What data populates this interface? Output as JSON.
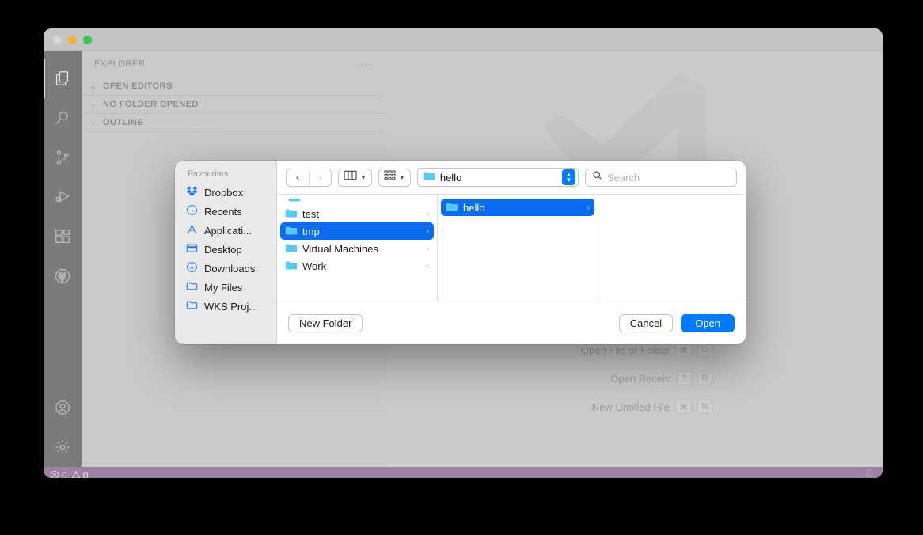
{
  "window": {
    "traffic_lights": [
      "close",
      "minimize",
      "maximize"
    ]
  },
  "activity_bar": {
    "items": [
      {
        "name": "explorer",
        "icon": "files-icon",
        "active": true
      },
      {
        "name": "search",
        "icon": "search-icon",
        "active": false
      },
      {
        "name": "source-control",
        "icon": "source-control-icon",
        "active": false
      },
      {
        "name": "run-and-debug",
        "icon": "run-debug-icon",
        "active": false
      },
      {
        "name": "extensions",
        "icon": "extensions-icon",
        "active": false
      },
      {
        "name": "github",
        "icon": "github-icon",
        "active": false
      }
    ],
    "bottom_items": [
      {
        "name": "accounts",
        "icon": "account-icon"
      },
      {
        "name": "manage",
        "icon": "gear-icon"
      }
    ]
  },
  "explorer": {
    "title": "EXPLORER",
    "more_actions": "···",
    "sections": [
      {
        "label": "OPEN EDITORS",
        "expanded": true,
        "chevron": "⌄"
      },
      {
        "label": "NO FOLDER OPENED",
        "expanded": false,
        "chevron": "›"
      },
      {
        "label": "OUTLINE",
        "expanded": false,
        "chevron": "›"
      }
    ]
  },
  "editor": {
    "watermark": "vscode-logo",
    "shortcuts": [
      {
        "label": "Open File or Folder",
        "keys": [
          "⌘",
          "O"
        ]
      },
      {
        "label": "Open Recent",
        "keys": [
          "^",
          "R"
        ]
      },
      {
        "label": "New Untitled File",
        "keys": [
          "⌘",
          "N"
        ]
      }
    ]
  },
  "status_bar": {
    "background": "#9d82a3",
    "errors": "0",
    "warnings": "0",
    "error_icon": "error-circle-icon",
    "warning_icon": "warning-triangle-icon",
    "bell_icon": "bell-icon"
  },
  "dialog": {
    "sidebar": {
      "group_title": "Favourites",
      "items": [
        {
          "label": "Dropbox",
          "icon": "dropbox-icon"
        },
        {
          "label": "Recents",
          "icon": "clock-icon"
        },
        {
          "label": "Applicati...",
          "icon": "applications-icon"
        },
        {
          "label": "Desktop",
          "icon": "desktop-icon"
        },
        {
          "label": "Downloads",
          "icon": "download-icon"
        },
        {
          "label": "My Files",
          "icon": "folder-icon"
        },
        {
          "label": "WKS Proj...",
          "icon": "folder-icon"
        }
      ]
    },
    "toolbar": {
      "back_label": "‹",
      "forward_label": "›",
      "view_mode": "column-view-icon",
      "group_mode": "group-by-icon",
      "path_label": "hello",
      "path_icon": "folder-icon",
      "stepper_icon": "up-down-stepper-icon",
      "search_placeholder": "Search",
      "search_value": "",
      "search_icon": "search-icon"
    },
    "columns": [
      {
        "name": "column-1",
        "items": [
          {
            "label": "test",
            "selected": false,
            "has_children": true
          },
          {
            "label": "tmp",
            "selected": true,
            "has_children": true
          },
          {
            "label": "Virtual Machines",
            "selected": false,
            "has_children": true
          },
          {
            "label": "Work",
            "selected": false,
            "has_children": true
          }
        ]
      },
      {
        "name": "column-2",
        "items": [
          {
            "label": "hello",
            "selected": true,
            "has_children": true
          }
        ]
      },
      {
        "name": "column-3",
        "items": []
      }
    ],
    "footer": {
      "new_folder_label": "New Folder",
      "cancel_label": "Cancel",
      "open_label": "Open"
    },
    "accent_color": "#007aff",
    "selection_color": "#0a6cf0"
  }
}
